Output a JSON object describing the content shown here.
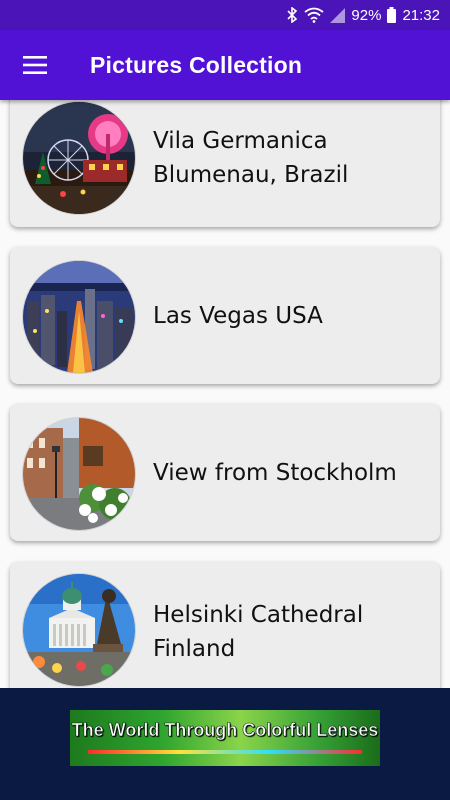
{
  "status_bar": {
    "battery": "92%",
    "time": "21:32",
    "icons": [
      "bluetooth-icon",
      "wifi-icon",
      "signal-icon",
      "battery-icon"
    ]
  },
  "app_bar": {
    "menu_icon": "hamburger-menu-icon",
    "title": "Pictures Collection",
    "color": "#5112d6"
  },
  "items": [
    {
      "label": "Vila Germanica\nBlumenau, Brazil",
      "thumb": "vila-germanica-photo"
    },
    {
      "label": "Las Vegas USA",
      "thumb": "las-vegas-photo"
    },
    {
      "label": "View from Stockholm",
      "thumb": "stockholm-photo"
    },
    {
      "label": "Helsinki Cathedral\nFinland",
      "thumb": "helsinki-cathedral-photo"
    }
  ],
  "ad_banner": {
    "text": "The World Through Colorful Lenses"
  }
}
